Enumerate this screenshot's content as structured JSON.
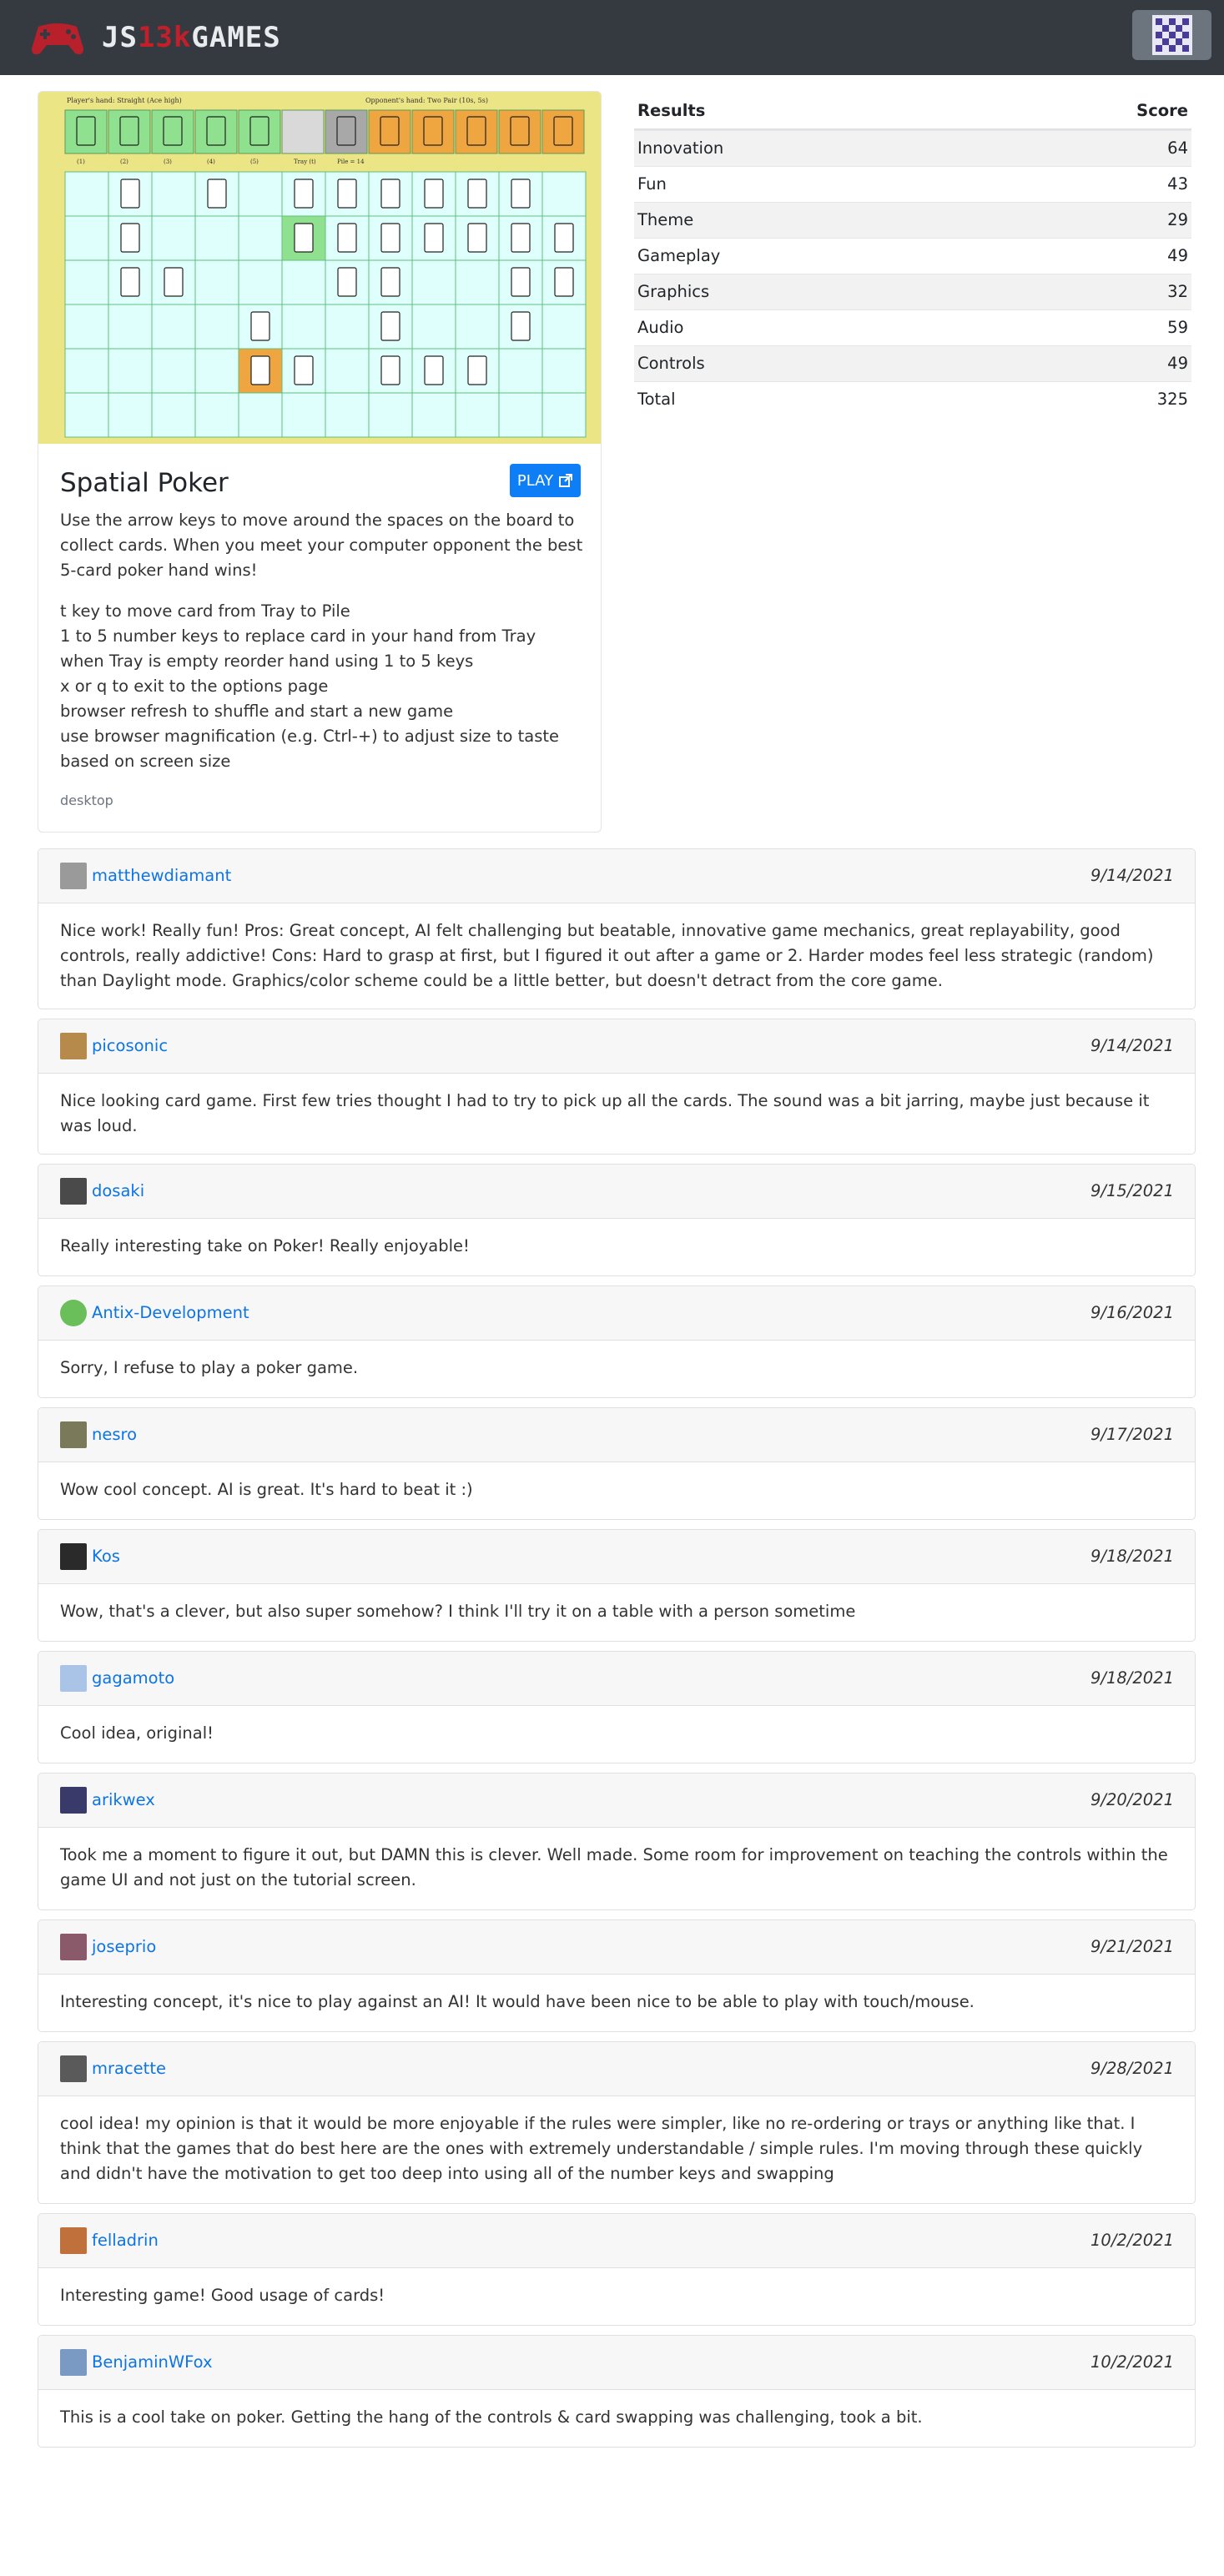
{
  "navbar": {
    "brand_prefix": "JS",
    "brand_accent": "13k",
    "brand_suffix": "GAMES"
  },
  "game": {
    "title": "Spatial Poker",
    "play_label": "PLAY",
    "description": "Use the arrow keys to move around the spaces on the board to collect cards. When you meet your computer opponent the best 5-card poker hand wins!",
    "instructions": [
      "t key to move card from Tray to Pile",
      "1 to 5 number keys to replace card in your hand from Tray",
      "when Tray is empty reorder hand using 1 to 5 keys",
      "x or q to exit to the options page",
      "browser refresh to shuffle and start a new game",
      "use browser magnification (e.g. Ctrl-+) to adjust size to taste based on screen size"
    ],
    "platform": "desktop",
    "thumbnail": {
      "player_hand_label": "Player's hand: Straight (Ace high)",
      "opponent_hand_label": "Opponent's hand: Two Pair (10s, 5s)",
      "slot_labels": [
        "(1)",
        "(2)",
        "(3)",
        "(4)",
        "(5)",
        "Tray (t)",
        "Pile = 14"
      ]
    }
  },
  "results": {
    "header_label": "Results",
    "header_score": "Score",
    "rows": [
      {
        "label": "Innovation",
        "score": "64"
      },
      {
        "label": "Fun",
        "score": "43"
      },
      {
        "label": "Theme",
        "score": "29"
      },
      {
        "label": "Gameplay",
        "score": "49"
      },
      {
        "label": "Graphics",
        "score": "32"
      },
      {
        "label": "Audio",
        "score": "59"
      },
      {
        "label": "Controls",
        "score": "49"
      },
      {
        "label": "Total",
        "score": "325"
      }
    ]
  },
  "comments": [
    {
      "user": "matthewdiamant",
      "date": "9/14/2021",
      "text": "Nice work! Really fun! Pros: Great concept, AI felt challenging but beatable, innovative game mechanics, great replayability, good controls, really addictive! Cons: Hard to grasp at first, but I figured it out after a game or 2. Harder modes feel less strategic (random) than Daylight mode. Graphics/color scheme could be a little better, but doesn't detract from the core game.",
      "avatar_color": "#9a9a9a"
    },
    {
      "user": "picosonic",
      "date": "9/14/2021",
      "text": "Nice looking card game. First few tries thought I had to try to pick up all the cards. The sound was a bit jarring, maybe just because it was loud.",
      "avatar_color": "#b58a4a"
    },
    {
      "user": "dosaki",
      "date": "9/15/2021",
      "text": "Really interesting take on Poker! Really enjoyable!",
      "avatar_color": "#4a4a4a"
    },
    {
      "user": "Antix-Development",
      "date": "9/16/2021",
      "text": "Sorry, I refuse to play a poker game.",
      "avatar_color": "#6abf5a"
    },
    {
      "user": "nesro",
      "date": "9/17/2021",
      "text": "Wow cool concept. AI is great. It's hard to beat it :)",
      "avatar_color": "#7a7a5a"
    },
    {
      "user": "Kos",
      "date": "9/18/2021",
      "text": "Wow, that's a clever, but also super somehow? I think I'll try it on a table with a person sometime",
      "avatar_color": "#2a2a2a"
    },
    {
      "user": "gagamoto",
      "date": "9/18/2021",
      "text": "Cool idea, original!",
      "avatar_color": "#a9c4e6"
    },
    {
      "user": "arikwex",
      "date": "9/20/2021",
      "text": "Took me a moment to figure it out, but DAMN this is clever. Well made. Some room for improvement on teaching the controls within the game UI and not just on the tutorial screen.",
      "avatar_color": "#3a3a6a"
    },
    {
      "user": "joseprio",
      "date": "9/21/2021",
      "text": "Interesting concept, it's nice to play against an AI! It would have been nice to be able to play with touch/mouse.",
      "avatar_color": "#8a5a6a"
    },
    {
      "user": "mracette",
      "date": "9/28/2021",
      "text": "cool idea! my opinion is that it would be more enjoyable if the rules were simpler, like no re-ordering or trays or anything like that. I think that the games that do best here are the ones with extremely understandable / simple rules. I'm moving through these quickly and didn't have the motivation to get too deep into using all of the number keys and swapping",
      "avatar_color": "#5a5a5a"
    },
    {
      "user": "felladrin",
      "date": "10/2/2021",
      "text": "Interesting game! Good usage of cards!",
      "avatar_color": "#c0703a"
    },
    {
      "user": "BenjaminWFox",
      "date": "10/2/2021",
      "text": "This is a cool take on poker. Getting the hang of the controls & card swapping was challenging, took a bit.",
      "avatar_color": "#7a9ac4"
    }
  ]
}
